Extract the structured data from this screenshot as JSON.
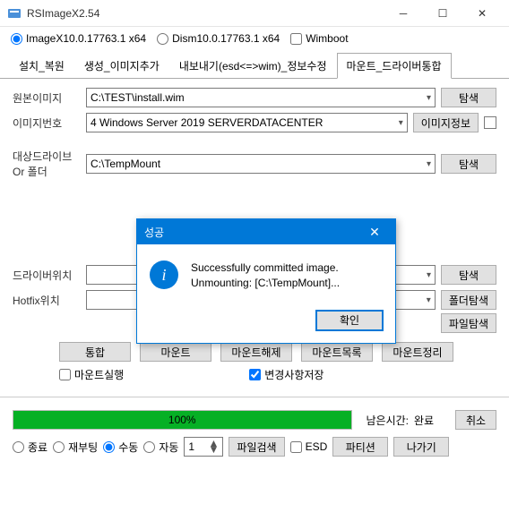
{
  "window": {
    "title": "RSImageX2.54"
  },
  "top": {
    "radio1": "ImageX10.0.17763.1 x64",
    "radio2": "Dism10.0.17763.1 x64",
    "wimboot": "Wimboot"
  },
  "tabs": {
    "t1": "설치_복원",
    "t2": "생성_이미지추가",
    "t3": "내보내기(esd<=>wim)_정보수정",
    "t4": "마운트_드라이버통합"
  },
  "fields": {
    "source_label": "원본이미지",
    "source_value": "C:\\TEST\\install.wim",
    "index_label": "이미지번호",
    "index_value": "4  Windows Server 2019 SERVERDATACENTER",
    "target_label": "대상드라이브\nOr 폴더",
    "target_value": "C:\\TempMount",
    "driver_label": "드라이버위치",
    "driver_value": "",
    "hotfix_label": "Hotfix위치",
    "hotfix_value": ""
  },
  "buttons": {
    "browse": "탐색",
    "imageinfo": "이미지정보",
    "folderbrowse": "폴더탐색",
    "filebrowse": "파일탐색",
    "integrate": "통합",
    "mount": "마운트",
    "unmount": "마운트해제",
    "mountlist": "마운트목록",
    "mountclean": "마운트정리",
    "filesearch": "파일검색",
    "partition": "파티션",
    "exit": "나가기",
    "cancel": "취소",
    "ok": "확인"
  },
  "checks": {
    "mountexec": "마운트실행",
    "savechanges": "변경사항저장",
    "esd": "ESD"
  },
  "progress": {
    "percent": "100%",
    "remain_label": "남은시간:",
    "remain_value": "완료"
  },
  "exitmode": {
    "shutdown": "종료",
    "reboot": "재부팅",
    "manual": "수동",
    "auto": "자동",
    "spinval": "1"
  },
  "dialog": {
    "title": "성공",
    "line1": "Successfully committed image.",
    "line2": "Unmounting: [C:\\TempMount]..."
  }
}
